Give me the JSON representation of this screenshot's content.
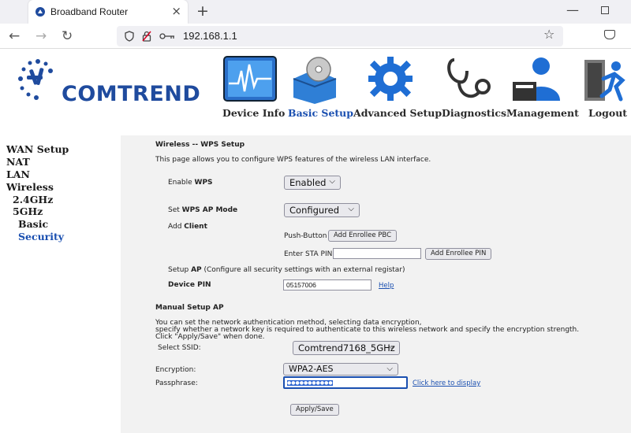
{
  "browser": {
    "tab_title": "Broadband Router",
    "tab_close": "×",
    "new_tab": "+",
    "url": "192.168.1.1",
    "window_min": "—"
  },
  "brand": {
    "name": "COMTREND",
    "color": "#1f4b9e"
  },
  "top_menu": [
    {
      "label": "Device Info",
      "icon": "device-info-icon"
    },
    {
      "label": "Basic Setup",
      "icon": "basic-setup-icon",
      "active": true
    },
    {
      "label": "Advanced Setup",
      "icon": "advanced-setup-icon"
    },
    {
      "label": "Diagnostics",
      "icon": "diagnostics-icon"
    },
    {
      "label": "Management",
      "icon": "management-icon"
    },
    {
      "label": "Logout",
      "icon": "logout-icon"
    }
  ],
  "sidebar": {
    "items": [
      {
        "label": "WAN Setup"
      },
      {
        "label": "NAT"
      },
      {
        "label": "LAN"
      },
      {
        "label": "Wireless"
      },
      {
        "label": "2.4GHz"
      },
      {
        "label": "5GHz"
      },
      {
        "label": "Basic"
      },
      {
        "label": "Security",
        "active": true
      }
    ]
  },
  "wps": {
    "section_title": "Wireless -- WPS Setup",
    "description": "This page allows you to configure WPS features of the wireless LAN interface.",
    "enable_label_prefix": "Enable ",
    "enable_label_bold": "WPS",
    "enable_value": "Enabled",
    "ap_mode_prefix": "Set ",
    "ap_mode_bold": "WPS AP Mode",
    "ap_mode_value": "Configured",
    "add_client_prefix": "Add ",
    "add_client_bold": "Client",
    "push_button_label": "Push-Button",
    "add_enrollee_pbc": "Add Enrollee PBC",
    "sta_pin_label": "Enter STA PIN",
    "sta_pin_value": "",
    "add_enrollee_pin": "Add Enrollee PIN",
    "setup_ap_prefix": "Setup ",
    "setup_ap_bold": "AP",
    "setup_ap_note": " (Configure all security settings with an external registar)",
    "device_pin_label": "Device PIN",
    "device_pin_value": "05157006",
    "help_link": "Help"
  },
  "manual": {
    "section_title": "Manual Setup AP",
    "desc_line1": "You can set the network authentication method, selecting data encryption,",
    "desc_line2": "specify whether a network key is required to authenticate to this wireless network and specify the encryption strength.",
    "desc_line3": "Click \"Apply/Save\" when done.",
    "ssid_label": "Select SSID:",
    "ssid_value": "Comtrend7168_5GHz",
    "encryption_label": "Encryption:",
    "encryption_value": "WPA2-AES",
    "passphrase_label": "Passphrase:",
    "passphrase_value": "●●●●●●●●●●●",
    "display_link": "Click here to display",
    "apply_button": "Apply/Save"
  },
  "colors": {
    "active_menu": "#1a4fb0",
    "content_bg": "#f2f2f2"
  }
}
